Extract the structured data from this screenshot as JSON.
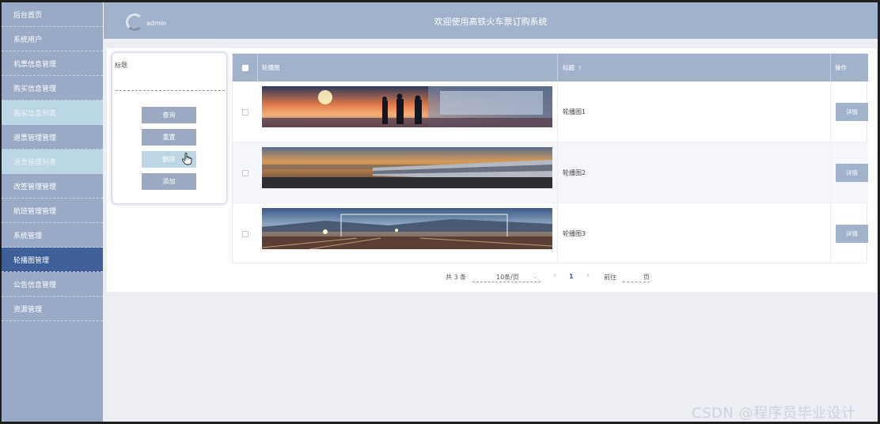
{
  "sidebar": {
    "items": [
      {
        "label": "后台首页"
      },
      {
        "label": "系统用户"
      },
      {
        "label": "机票信息管理"
      },
      {
        "label": "购买信息管理"
      },
      {
        "label": "购买信息列表"
      },
      {
        "label": "退票管理管理"
      },
      {
        "label": "退票管理列表"
      },
      {
        "label": "改签管理管理"
      },
      {
        "label": "航班管理管理"
      },
      {
        "label": "系统管理"
      },
      {
        "label": "轮播图管理"
      },
      {
        "label": "公告信息管理"
      },
      {
        "label": "资源管理"
      }
    ],
    "active_index": 10
  },
  "header": {
    "admin_name": "admin",
    "title": "欢迎使用高铁火车票订购系统"
  },
  "search": {
    "label": "标题",
    "value": "",
    "buttons": {
      "query": "查询",
      "reset": "重置",
      "delete": "删除",
      "add": "添加"
    }
  },
  "table": {
    "columns": {
      "image": "轮播图",
      "title": "标题",
      "sort_icon": "⇕",
      "actions": "操作"
    },
    "rows": [
      {
        "title": "轮播图1",
        "action": "详情",
        "image": "sunset-station-platform"
      },
      {
        "title": "轮播图2",
        "action": "详情",
        "image": "train-city-sunset"
      },
      {
        "title": "轮播图3",
        "action": "详情",
        "image": "railway-yard-dusk"
      }
    ]
  },
  "pagination": {
    "total": "共 3 条",
    "page_size": "10条/页",
    "prev_icon": "‹",
    "current_page": "1",
    "next_icon": "›",
    "goto_label": "前往",
    "page_suffix": "页"
  },
  "watermark": "CSDN @程序员毕业设计",
  "colors": {
    "sidebar": "#9aaac4",
    "sidebar_active": "#3f5f9b",
    "header": "#a3b2cb",
    "button": "#9ca9c0"
  }
}
